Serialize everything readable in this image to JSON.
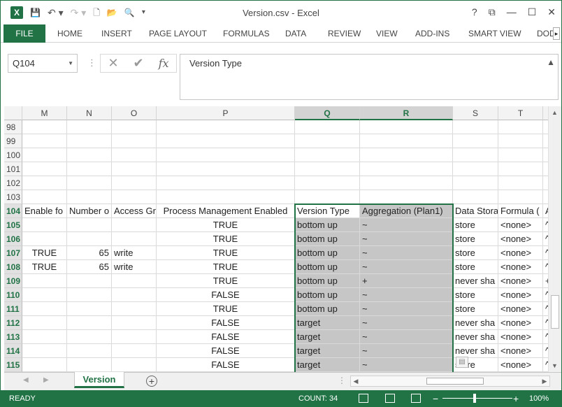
{
  "window": {
    "title": "Version.csv - Excel",
    "controls": {
      "help": "?",
      "restore": "⧉",
      "minimize": "—",
      "maximize": "☐",
      "close": "✕"
    }
  },
  "qat": {
    "logo": "X",
    "save": "💾",
    "undo": "↶ ▾",
    "redo": "↷ ▾",
    "new": "🗋",
    "open": "📂",
    "preview": "🔍",
    "customize": "▾"
  },
  "ribbon": {
    "tabs": [
      "FILE",
      "HOME",
      "INSERT",
      "PAGE LAYOUT",
      "FORMULAS",
      "DATA",
      "REVIEW",
      "VIEW",
      "ADD-INS",
      "SMART VIEW",
      "DOD"
    ],
    "more": "▸"
  },
  "formula_bar": {
    "name_box": "Q104",
    "cancel": "✕",
    "enter": "✔",
    "fx": "fx",
    "content": "Version Type"
  },
  "grid": {
    "columns": [
      "M",
      "N",
      "O",
      "P",
      "Q",
      "R",
      "S",
      "T",
      ""
    ],
    "selected_columns": [
      "Q",
      "R"
    ],
    "active_cell": "Q104",
    "rows": [
      {
        "num": "98",
        "cells": [
          "",
          "",
          "",
          "",
          "",
          "",
          "",
          ""
        ]
      },
      {
        "num": "99",
        "cells": [
          "",
          "",
          "",
          "",
          "",
          "",
          "",
          ""
        ]
      },
      {
        "num": "100",
        "cells": [
          "",
          "",
          "",
          "",
          "",
          "",
          "",
          ""
        ]
      },
      {
        "num": "101",
        "cells": [
          "",
          "",
          "",
          "",
          "",
          "",
          "",
          ""
        ]
      },
      {
        "num": "102",
        "cells": [
          "",
          "",
          "",
          "",
          "",
          "",
          "",
          ""
        ]
      },
      {
        "num": "103",
        "cells": [
          "",
          "",
          "",
          "",
          "",
          "",
          "",
          ""
        ]
      },
      {
        "num": "104",
        "cells": [
          "Enable fo",
          "Number o",
          "Access Gr",
          "Process Management Enabled",
          "Version Type",
          "Aggregation (Plan1)",
          "Data Stora",
          "Formula (",
          "A"
        ]
      },
      {
        "num": "105",
        "cells": [
          "",
          "",
          "",
          "TRUE",
          "bottom up",
          "~",
          "store",
          "<none>",
          "^"
        ]
      },
      {
        "num": "106",
        "cells": [
          "",
          "",
          "",
          "TRUE",
          "bottom up",
          "~",
          "store",
          "<none>",
          "^"
        ]
      },
      {
        "num": "107",
        "cells": [
          "TRUE",
          "65",
          "write",
          "TRUE",
          "bottom up",
          "~",
          "store",
          "<none>",
          "^"
        ]
      },
      {
        "num": "108",
        "cells": [
          "TRUE",
          "65",
          "write",
          "TRUE",
          "bottom up",
          "~",
          "store",
          "<none>",
          "^"
        ]
      },
      {
        "num": "109",
        "cells": [
          "",
          "",
          "",
          "TRUE",
          "bottom up",
          "+",
          "never sha",
          "<none>",
          "+"
        ]
      },
      {
        "num": "110",
        "cells": [
          "",
          "",
          "",
          "FALSE",
          "bottom up",
          "~",
          "store",
          "<none>",
          "^"
        ]
      },
      {
        "num": "111",
        "cells": [
          "",
          "",
          "",
          "TRUE",
          "bottom up",
          "~",
          "store",
          "<none>",
          "^"
        ]
      },
      {
        "num": "112",
        "cells": [
          "",
          "",
          "",
          "FALSE",
          "target",
          "~",
          "never sha",
          "<none>",
          "^"
        ]
      },
      {
        "num": "113",
        "cells": [
          "",
          "",
          "",
          "FALSE",
          "target",
          "~",
          "never sha",
          "<none>",
          "^"
        ]
      },
      {
        "num": "114",
        "cells": [
          "",
          "",
          "",
          "FALSE",
          "target",
          "~",
          "never sha",
          "<none>",
          "^"
        ]
      },
      {
        "num": "115",
        "cells": [
          "",
          "",
          "",
          "FALSE",
          "target",
          "~",
          "store",
          "<none>",
          "^"
        ]
      }
    ]
  },
  "sheets": {
    "tabs": [
      "Version"
    ],
    "active": "Version",
    "add": "+",
    "prev": "◀",
    "next": "▶",
    "more": "⋮"
  },
  "status": {
    "ready": "READY",
    "count": "COUNT: 34",
    "zoom": "100%",
    "zoom_minus": "−",
    "zoom_plus": "+"
  }
}
